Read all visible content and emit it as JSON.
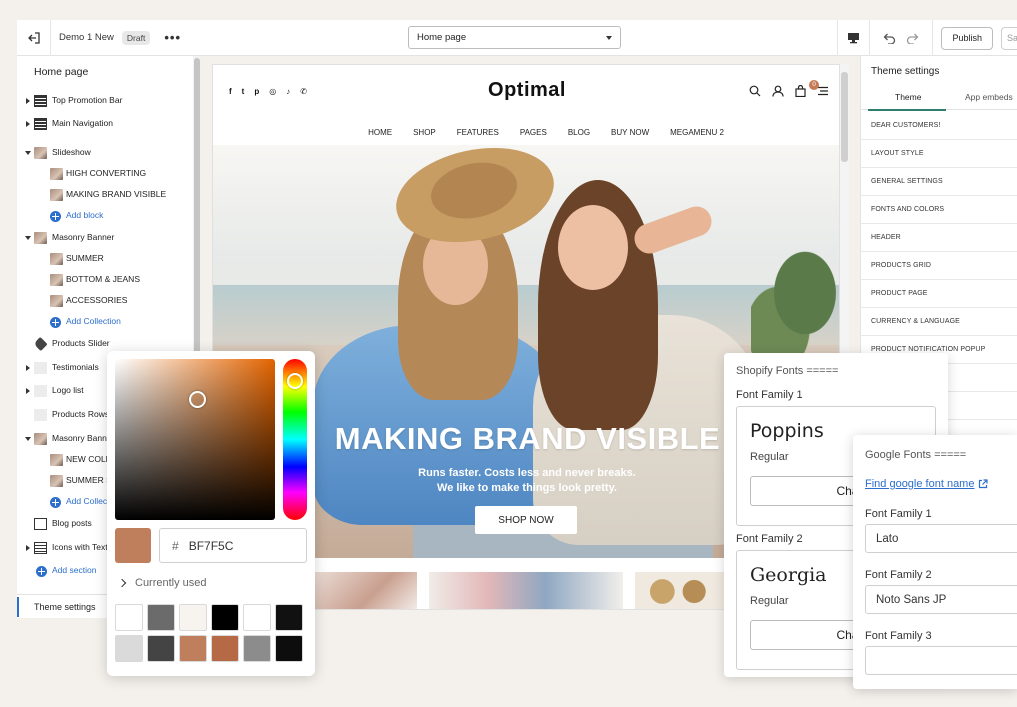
{
  "topbar": {
    "store_name": "Demo 1 New",
    "status_badge": "Draft",
    "more": "•••",
    "page_select": "Home page",
    "publish_label": "Publish",
    "save_label": "Save"
  },
  "sidebar": {
    "title": "Home page",
    "items": [
      {
        "label": "Top Promotion Bar"
      },
      {
        "label": "Main Navigation"
      },
      {
        "label": "Slideshow"
      },
      {
        "label": "HIGH CONVERTING"
      },
      {
        "label": "MAKING BRAND VISIBLE"
      },
      {
        "label": "Add block"
      },
      {
        "label": "Masonry Banner"
      },
      {
        "label": "SUMMER"
      },
      {
        "label": "BOTTOM & JEANS"
      },
      {
        "label": "ACCESSORIES"
      },
      {
        "label": "Add Collection"
      },
      {
        "label": "Products Slider"
      },
      {
        "label": "Testimonials"
      },
      {
        "label": "Logo list"
      },
      {
        "label": "Products Rows"
      },
      {
        "label": "Masonry Banner"
      },
      {
        "label": "NEW COLLECTION"
      },
      {
        "label": "SUMMER SALE"
      },
      {
        "label": "Add Collection"
      },
      {
        "label": "Blog posts"
      },
      {
        "label": "Icons with Text"
      },
      {
        "label": "Add section"
      }
    ],
    "theme_settings": "Theme settings"
  },
  "preview": {
    "socials": [
      "f",
      "t",
      "p",
      "◎",
      "♪",
      "✆"
    ],
    "logo": "Optimal",
    "cart_count": "0",
    "nav": [
      "HOME",
      "SHOP",
      "FEATURES",
      "PAGES",
      "BLOG",
      "BUY NOW",
      "MEGAMENU 2"
    ],
    "hero_title": "MAKING BRAND VISIBLE",
    "hero_line1": "Runs faster. Costs less and never breaks.",
    "hero_line2": "We like to make things look pretty.",
    "hero_button": "SHOP NOW"
  },
  "theme_panel": {
    "title": "Theme settings",
    "tabs": [
      "Theme",
      "App embeds"
    ],
    "rows": [
      "DEAR CUSTOMERS!",
      "LAYOUT STYLE",
      "GENERAL SETTINGS",
      "FONTS AND COLORS",
      "HEADER",
      "PRODUCTS GRID",
      "PRODUCT PAGE",
      "CURRENCY & LANGUAGE",
      "PRODUCT NOTIFICATION POPUP"
    ]
  },
  "picker": {
    "hex_prefix": "#",
    "hex_value": "BF7F5C",
    "current_color": "#bf7f5c",
    "currently_used_label": "Currently used",
    "swatches": [
      "#ffffff",
      "#6b6b6b",
      "#f7f3ee",
      "#000000",
      "#ffffff",
      "#111111",
      "#dadada",
      "#444444",
      "#bf7f5c",
      "#b56a45",
      "#8c8c8c",
      "#0d0d0d"
    ]
  },
  "shopify_fonts": {
    "heading": "Shopify Fonts =====",
    "family1_label": "Font Family 1",
    "family1_name": "Poppins",
    "family1_weight": "Regular",
    "family2_label": "Font Family 2",
    "family2_name": "Georgia",
    "family2_weight": "Regular",
    "change_label": "Change"
  },
  "google_fonts": {
    "heading": "Google Fonts =====",
    "link": "Find google font name",
    "family1_label": "Font Family 1",
    "family1_value": "Lato",
    "family2_label": "Font Family 2",
    "family2_value": "Noto Sans JP",
    "family3_label": "Font Family 3",
    "family3_value": ""
  }
}
